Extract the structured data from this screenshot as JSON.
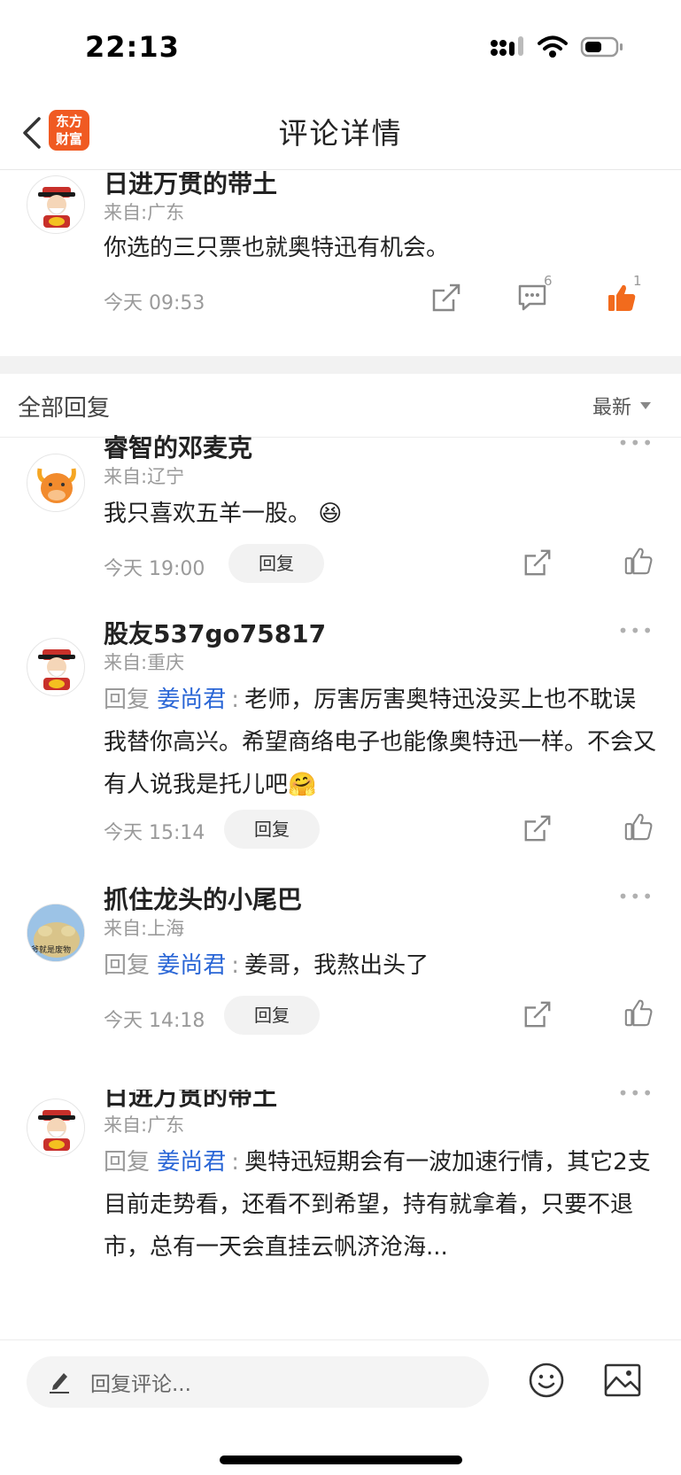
{
  "status_bar": {
    "time": "22:13"
  },
  "nav": {
    "title": "评论详情",
    "logo_line1": "东方",
    "logo_line2": "财富"
  },
  "main_comment": {
    "username": "日进万贯的带土",
    "location": "来自:广东",
    "content": "你选的三只票也就奥特迅有机会。",
    "time": "今天 09:53",
    "reply_count": "6",
    "like_count": "1"
  },
  "replies_header": {
    "title": "全部回复",
    "sort": "最新"
  },
  "replies": [
    {
      "username": "睿智的邓麦克",
      "location": "来自:辽宁",
      "content": "我只喜欢五羊一股。",
      "emoji": "😆",
      "time": "今天 19:00",
      "reply_label": "回复"
    },
    {
      "username": "股友537go75817",
      "location": "来自:重庆",
      "reply_prefix": "回复",
      "mention": "姜尚君",
      "separator": ":",
      "content": "老师，厉害厉害奥特迅没买上也不耽误我替你高兴。希望商络电子也能像奥特迅一样。不会又有人说我是托儿吧",
      "emoji": "🤗",
      "time": "今天 15:14",
      "reply_label": "回复"
    },
    {
      "username": "抓住龙头的小尾巴",
      "location": "来自:上海",
      "avatar_text": "爷就是废物",
      "reply_prefix": "回复",
      "mention": "姜尚君",
      "separator": ":",
      "content": "姜哥，我熬出头了",
      "time": "今天 14:18",
      "reply_label": "回复"
    },
    {
      "username": "日进万贯的带土",
      "location": "来自:广东",
      "reply_prefix": "回复",
      "mention": "姜尚君",
      "separator": ":",
      "content": "奥特迅短期会有一波加速行情，其它2支目前走势看，还看不到希望，持有就拿着，只要不退市，总有一天会直挂云帆济沧海..."
    }
  ],
  "more_label": "•••",
  "bottom_bar": {
    "input_placeholder": "回复评论..."
  },
  "colors": {
    "accent": "#f05a22",
    "mention": "#2a66d6",
    "like_active": "#f26b1d"
  }
}
